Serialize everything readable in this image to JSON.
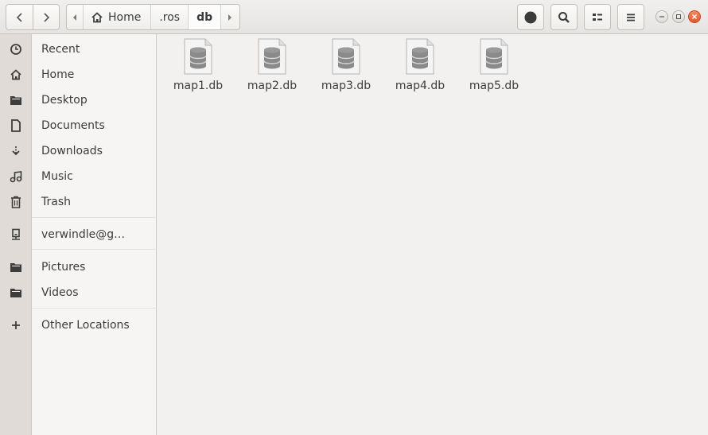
{
  "header": {
    "breadcrumbs": [
      {
        "label": "Home",
        "icon": "home-icon"
      },
      {
        "label": ".ros"
      },
      {
        "label": "db",
        "current": true
      }
    ]
  },
  "sidebar": {
    "items": [
      {
        "label": "Recent",
        "icon": "recent-icon"
      },
      {
        "label": "Home",
        "icon": "home-icon"
      },
      {
        "label": "Desktop",
        "icon": "folder-icon"
      },
      {
        "label": "Documents",
        "icon": "document-icon"
      },
      {
        "label": "Downloads",
        "icon": "download-icon"
      },
      {
        "label": "Music",
        "icon": "music-icon"
      },
      {
        "label": "Trash",
        "icon": "trash-icon"
      },
      {
        "label": "verwindle@g…",
        "icon": "network-drive-icon"
      },
      {
        "label": "Pictures",
        "icon": "folder-icon"
      },
      {
        "label": "Videos",
        "icon": "folder-icon"
      },
      {
        "label": "Other Locations",
        "icon": "plus-icon"
      }
    ]
  },
  "files": [
    {
      "name": "map1.db",
      "icon": "database-file-icon"
    },
    {
      "name": "map2.db",
      "icon": "database-file-icon"
    },
    {
      "name": "map3.db",
      "icon": "database-file-icon"
    },
    {
      "name": "map4.db",
      "icon": "database-file-icon"
    },
    {
      "name": "map5.db",
      "icon": "database-file-icon"
    }
  ]
}
